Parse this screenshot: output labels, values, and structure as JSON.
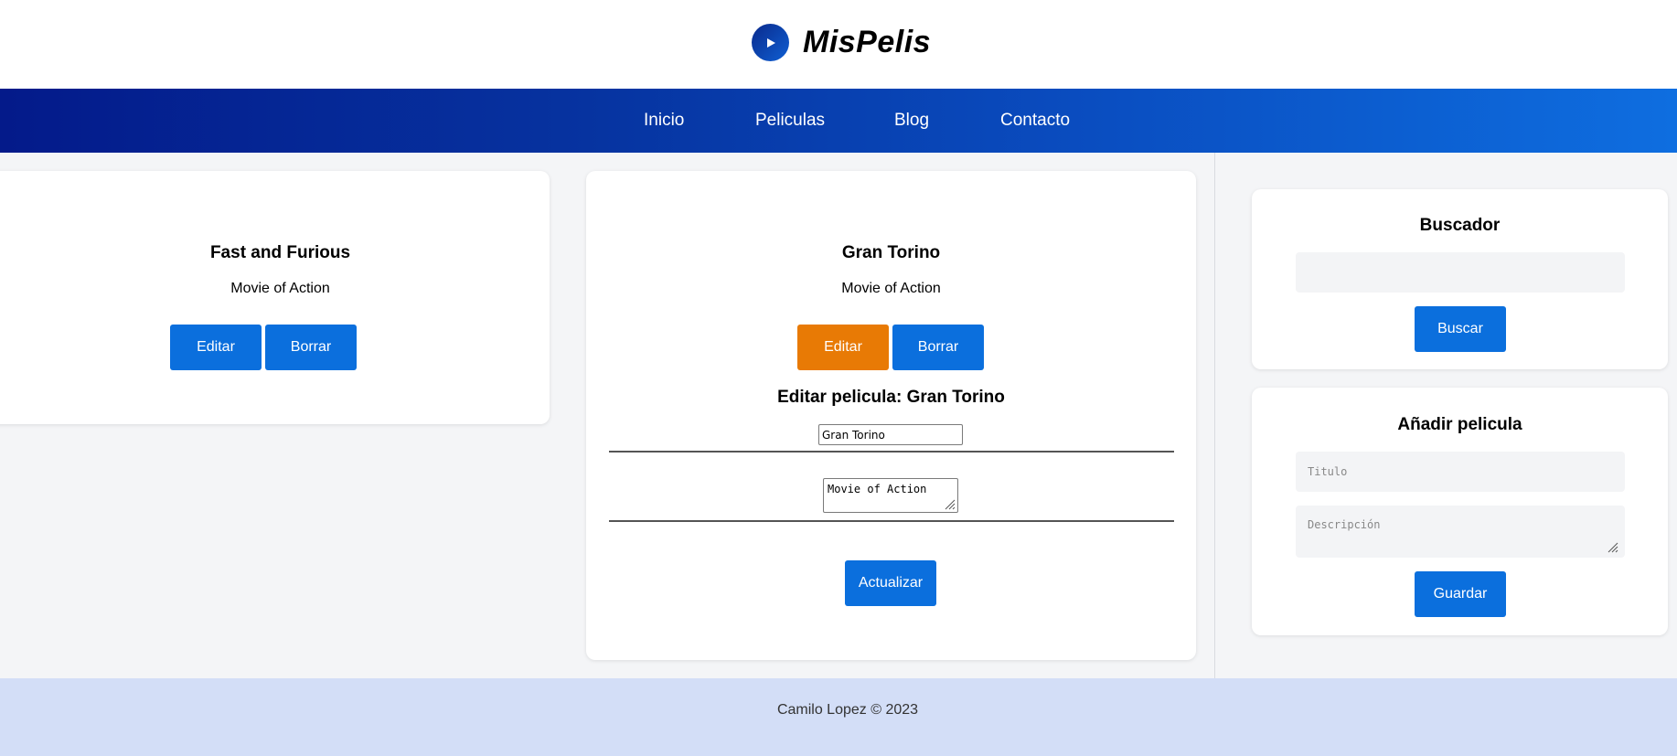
{
  "brand": {
    "name": "MisPelis",
    "logo_icon": "play-icon"
  },
  "nav": {
    "items": [
      "Inicio",
      "Peliculas",
      "Blog",
      "Contacto"
    ]
  },
  "movies": [
    {
      "title": "Fast and Furious",
      "description": "Movie of Action",
      "edit_label": "Editar",
      "delete_label": "Borrar"
    },
    {
      "title": "Gran Torino",
      "description": "Movie of Action",
      "edit_label": "Editar",
      "delete_label": "Borrar"
    }
  ],
  "edit_form": {
    "heading": "Editar pelicula: Gran Torino",
    "title_value": "Gran Torino",
    "description_value": "Movie of Action",
    "submit_label": "Actualizar"
  },
  "search": {
    "heading": "Buscador",
    "input_value": "",
    "button_label": "Buscar"
  },
  "add_movie": {
    "heading": "Añadir pelicula",
    "title_placeholder": "Titulo",
    "description_placeholder": "Descripción",
    "button_label": "Guardar"
  },
  "footer": {
    "text": "Camilo Lopez © 2023"
  },
  "colors": {
    "primary_button": "#0b6fdd",
    "active_button": "#e87a05",
    "footer_bg": "#d3def7"
  }
}
